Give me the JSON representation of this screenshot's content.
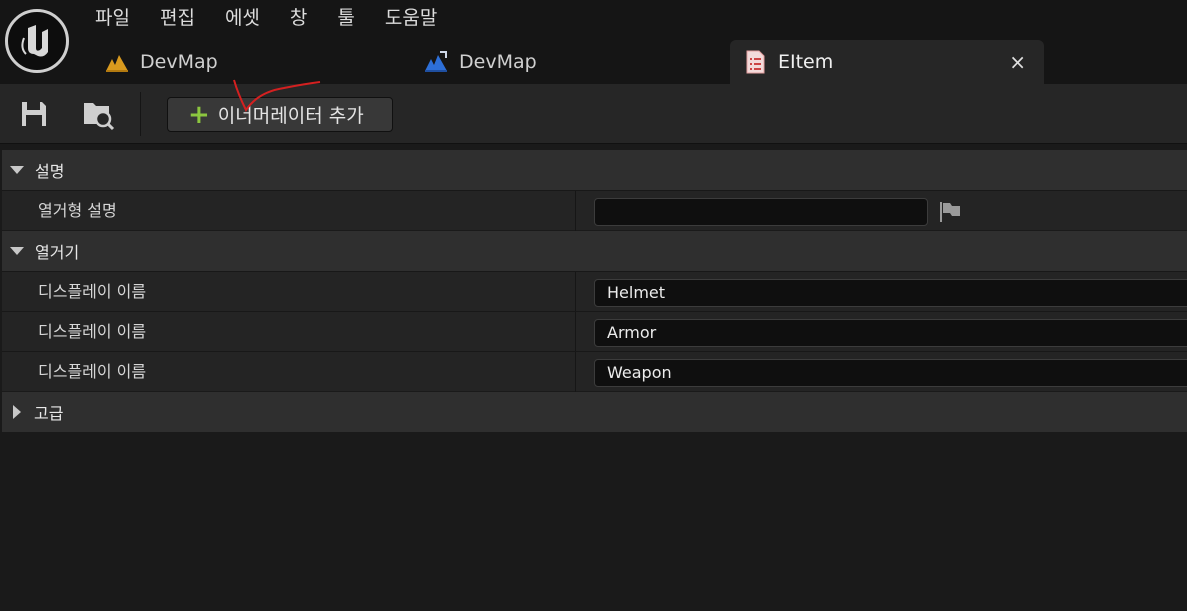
{
  "menu": {
    "items": [
      "파일",
      "편집",
      "에셋",
      "창",
      "툴",
      "도움말"
    ]
  },
  "tabs": [
    {
      "label": "DevMap",
      "icon": "level-icon"
    },
    {
      "label": "DevMap",
      "icon": "level-blueprint-icon"
    },
    {
      "label": "EItem",
      "icon": "enum-asset-icon",
      "active": true
    }
  ],
  "tab_close_glyph": "×",
  "toolbar": {
    "add_button_label": "이너머레이터 추가",
    "plus_glyph": "+"
  },
  "details": {
    "categories": {
      "description": {
        "title": "설명",
        "row_label": "열거형 설명",
        "value": ""
      },
      "enumerators": {
        "title": "열거기",
        "rows": [
          {
            "label": "디스플레이 이름",
            "value": "Helmet"
          },
          {
            "label": "디스플레이 이름",
            "value": "Armor"
          },
          {
            "label": "디스플레이 이름",
            "value": "Weapon"
          }
        ]
      },
      "advanced": {
        "title": "고급"
      }
    }
  },
  "colors": {
    "accent_plus": "#8cc63f",
    "selection_corner": "#1c7ad4",
    "annotation_red": "#d42020"
  }
}
